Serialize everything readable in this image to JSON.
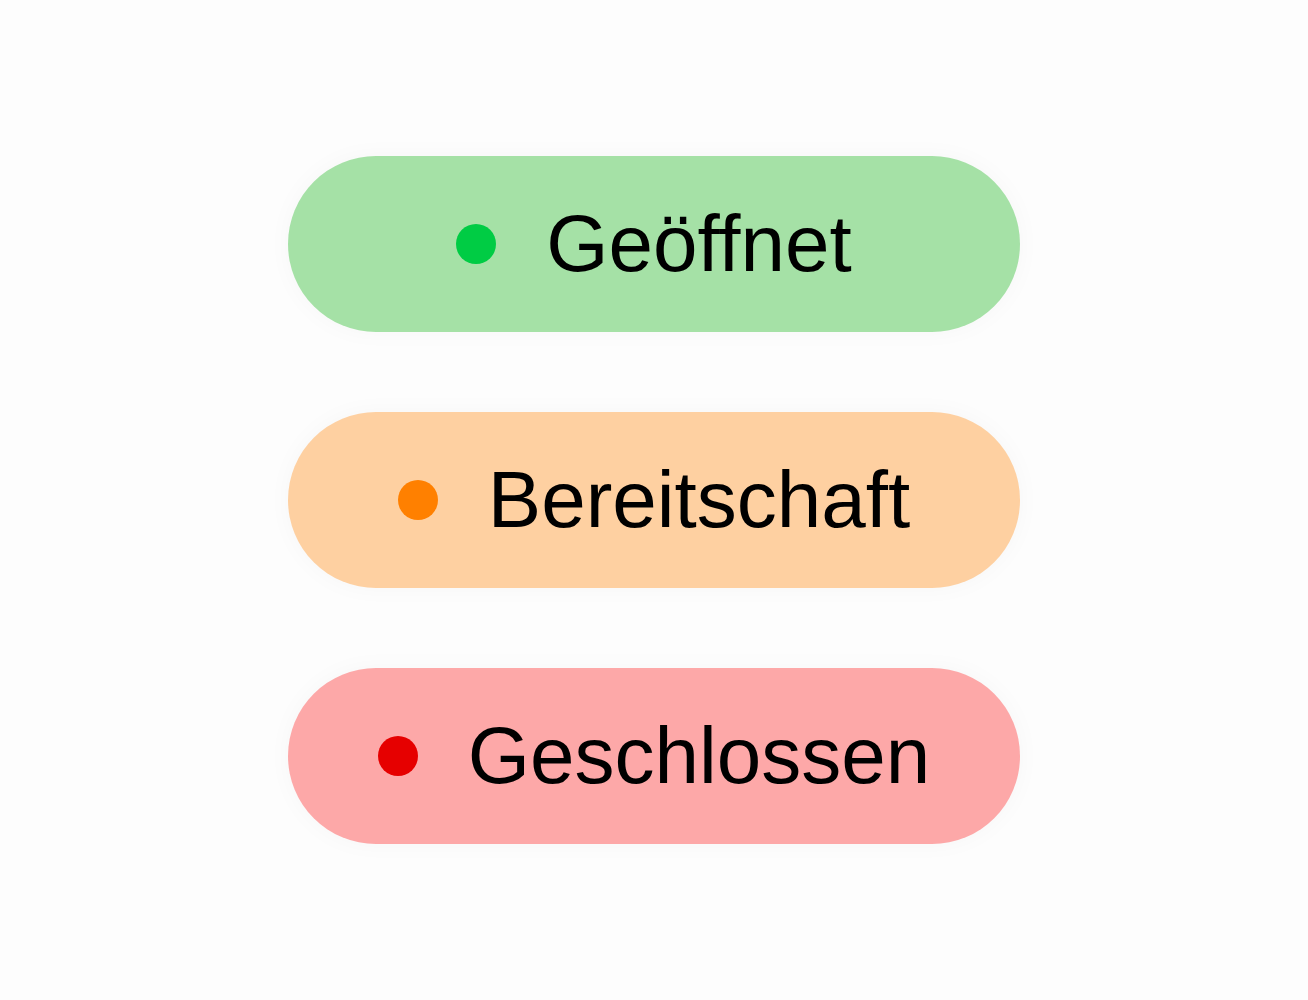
{
  "statuses": [
    {
      "label": "Geöffnet",
      "color": "#a5e1a6",
      "dot": {
        "color": "#00cc44"
      }
    },
    {
      "label": "Bereitschaft",
      "color": "#fed0a1",
      "dot": {
        "color": "#ff8000"
      }
    },
    {
      "label": "Geschlossen",
      "color": "#fda8a8",
      "dot": {
        "color": "#e60000"
      }
    }
  ]
}
